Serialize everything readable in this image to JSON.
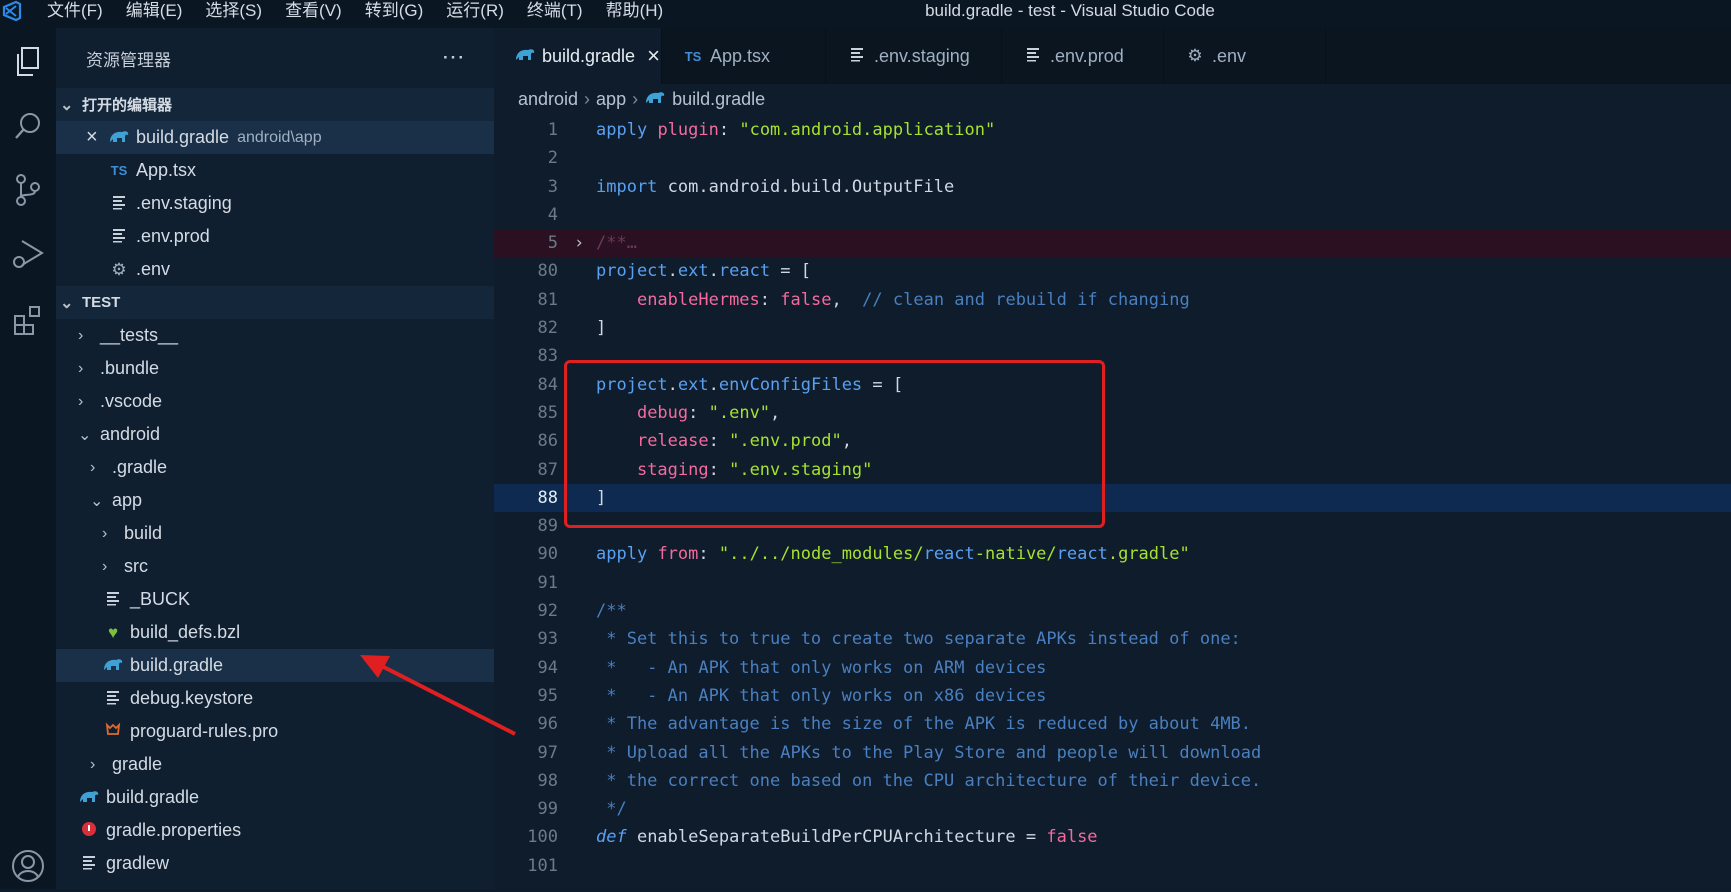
{
  "menu": [
    "文件(F)",
    "编辑(E)",
    "选择(S)",
    "查看(V)",
    "转到(G)",
    "运行(R)",
    "终端(T)",
    "帮助(H)"
  ],
  "window_title": "build.gradle - test - Visual Studio Code",
  "activity_icons": [
    "explorer-icon",
    "search-icon",
    "source-control-icon",
    "run-debug-icon",
    "extensions-icon",
    "account-icon"
  ],
  "sidebar": {
    "title": "资源管理器",
    "more": "···",
    "open_editors_label": "打开的编辑器",
    "open_editors": [
      {
        "name": "build.gradle",
        "path": "android\\app",
        "icon": "gradle-icon"
      },
      {
        "name": "App.tsx",
        "icon": "ts-icon"
      },
      {
        "name": ".env.staging",
        "icon": "file-lines-icon"
      },
      {
        "name": ".env.prod",
        "icon": "file-lines-icon"
      },
      {
        "name": ".env",
        "icon": "gear-icon"
      }
    ],
    "project_label": "TEST",
    "tree": [
      {
        "name": "__tests__",
        "folder": true,
        "expanded": false
      },
      {
        "name": ".bundle",
        "folder": true,
        "expanded": false
      },
      {
        "name": ".vscode",
        "folder": true,
        "expanded": false
      },
      {
        "name": "android",
        "folder": true,
        "expanded": true
      },
      {
        "name": ".gradle",
        "folder": true,
        "expanded": false
      },
      {
        "name": "app",
        "folder": true,
        "expanded": true
      },
      {
        "name": "build",
        "folder": true,
        "expanded": false
      },
      {
        "name": "src",
        "folder": true,
        "expanded": false
      },
      {
        "name": "_BUCK",
        "icon": "file-lines-icon"
      },
      {
        "name": "build_defs.bzl",
        "icon": "heart-icon"
      },
      {
        "name": "build.gradle",
        "icon": "gradle-icon",
        "selected": true
      },
      {
        "name": "debug.keystore",
        "icon": "file-lines-icon"
      },
      {
        "name": "proguard-rules.pro",
        "icon": "proguard-icon"
      },
      {
        "name": "gradle",
        "folder": true,
        "expanded": false
      },
      {
        "name": "build.gradle",
        "icon": "gradle-icon"
      },
      {
        "name": "gradle.properties",
        "icon": "properties-icon"
      },
      {
        "name": "gradlew",
        "icon": "file-lines-icon"
      }
    ]
  },
  "tabs": [
    {
      "label": "build.gradle",
      "icon": "gradle-icon",
      "active": true,
      "close": "×"
    },
    {
      "label": "App.tsx",
      "icon": "ts-icon"
    },
    {
      "label": ".env.staging",
      "icon": "file-lines-icon"
    },
    {
      "label": ".env.prod",
      "icon": "file-lines-icon"
    },
    {
      "label": ".env",
      "icon": "gear-icon"
    }
  ],
  "breadcrumb": [
    "android",
    "app",
    "build.gradle"
  ],
  "code_lines": [
    {
      "num": "1",
      "text": "apply plugin: \"com.android.application\""
    },
    {
      "num": "2",
      "text": ""
    },
    {
      "num": "3",
      "text": "import com.android.build.OutputFile"
    },
    {
      "num": "4",
      "text": ""
    },
    {
      "num": "5",
      "text": "/**…",
      "fold": true
    },
    {
      "num": "80",
      "text": "project.ext.react = ["
    },
    {
      "num": "81",
      "text": "    enableHermes: false,  // clean and rebuild if changing"
    },
    {
      "num": "82",
      "text": "]"
    },
    {
      "num": "83",
      "text": ""
    },
    {
      "num": "84",
      "text": "project.ext.envConfigFiles = ["
    },
    {
      "num": "85",
      "text": "    debug: \".env\","
    },
    {
      "num": "86",
      "text": "    release: \".env.prod\","
    },
    {
      "num": "87",
      "text": "    staging: \".env.staging\""
    },
    {
      "num": "88",
      "text": "]",
      "current": true
    },
    {
      "num": "89",
      "text": ""
    },
    {
      "num": "90",
      "text": "apply from: \"../../node_modules/react-native/react.gradle\""
    },
    {
      "num": "91",
      "text": ""
    },
    {
      "num": "92",
      "text": "/**"
    },
    {
      "num": "93",
      "text": " * Set this to true to create two separate APKs instead of one:"
    },
    {
      "num": "94",
      "text": " *   - An APK that only works on ARM devices"
    },
    {
      "num": "95",
      "text": " *   - An APK that only works on x86 devices"
    },
    {
      "num": "96",
      "text": " * The advantage is the size of the APK is reduced by about 4MB."
    },
    {
      "num": "97",
      "text": " * Upload all the APKs to the Play Store and people will download"
    },
    {
      "num": "98",
      "text": " * the correct one based on the CPU architecture of their device."
    },
    {
      "num": "99",
      "text": " */"
    },
    {
      "num": "100",
      "text": "def enableSeparateBuildPerCPUArchitecture = false"
    },
    {
      "num": "101",
      "text": ""
    }
  ],
  "colors": {
    "annotation": "#e02020",
    "background": "#0e1c2c"
  }
}
